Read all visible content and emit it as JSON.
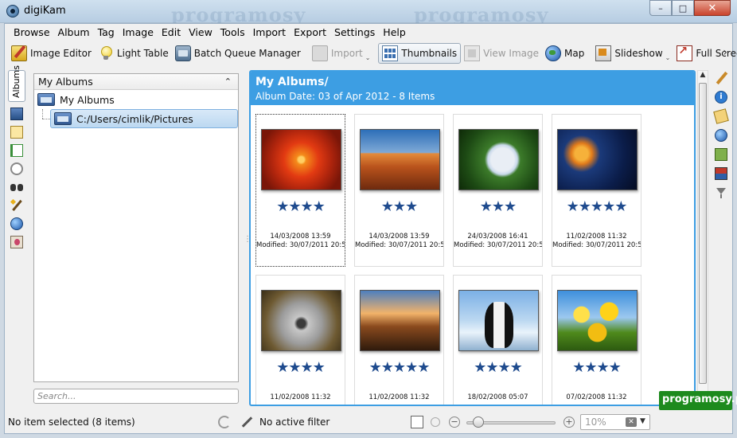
{
  "window": {
    "title": "digiKam",
    "watermark": "programosy"
  },
  "menu": [
    "Browse",
    "Album",
    "Tag",
    "Image",
    "Edit",
    "View",
    "Tools",
    "Import",
    "Export",
    "Settings",
    "Help"
  ],
  "toolbar": {
    "image_editor": "Image Editor",
    "light_table": "Light Table",
    "batch_queue": "Batch Queue Manager",
    "import": "Import",
    "thumbnails": "Thumbnails",
    "view_image": "View Image",
    "map": "Map",
    "slideshow": "Slideshow",
    "full_screen": "Full Screen"
  },
  "left_tab": {
    "label": "Albums"
  },
  "tree": {
    "header": "My Albums",
    "root": "My Albums",
    "child": "C:/Users/cimlik/Pictures"
  },
  "search": {
    "placeholder": "Search..."
  },
  "album": {
    "title": "My Albums/",
    "subtitle": "Album Date: 03 of Apr 2012 - 8 Items"
  },
  "thumbnails": [
    {
      "stars": "★★★★",
      "date": "14/03/2008 13:59",
      "modified": "Modified: 30/07/2011 20:5"
    },
    {
      "stars": "★★★",
      "date": "14/03/2008 13:59",
      "modified": "Modified: 30/07/2011 20:5"
    },
    {
      "stars": "★★★",
      "date": "24/03/2008 16:41",
      "modified": "Modified: 30/07/2011 20:5"
    },
    {
      "stars": "★★★★★",
      "date": "11/02/2008 11:32",
      "modified": "Modified: 30/07/2011 20:5"
    },
    {
      "stars": "★★★★",
      "date": "11/02/2008 11:32",
      "modified": ""
    },
    {
      "stars": "★★★★★",
      "date": "11/02/2008 11:32",
      "modified": ""
    },
    {
      "stars": "★★★★",
      "date": "18/02/2008 05:07",
      "modified": ""
    },
    {
      "stars": "★★★★",
      "date": "07/02/2008 11:32",
      "modified": ""
    }
  ],
  "status": {
    "selection": "No item selected (8 items)",
    "filter": "No active filter",
    "zoom": "10%"
  },
  "badge": "programosy.pl",
  "colors": {
    "accent": "#3d9ee3",
    "stars": "#1f4b8e"
  }
}
